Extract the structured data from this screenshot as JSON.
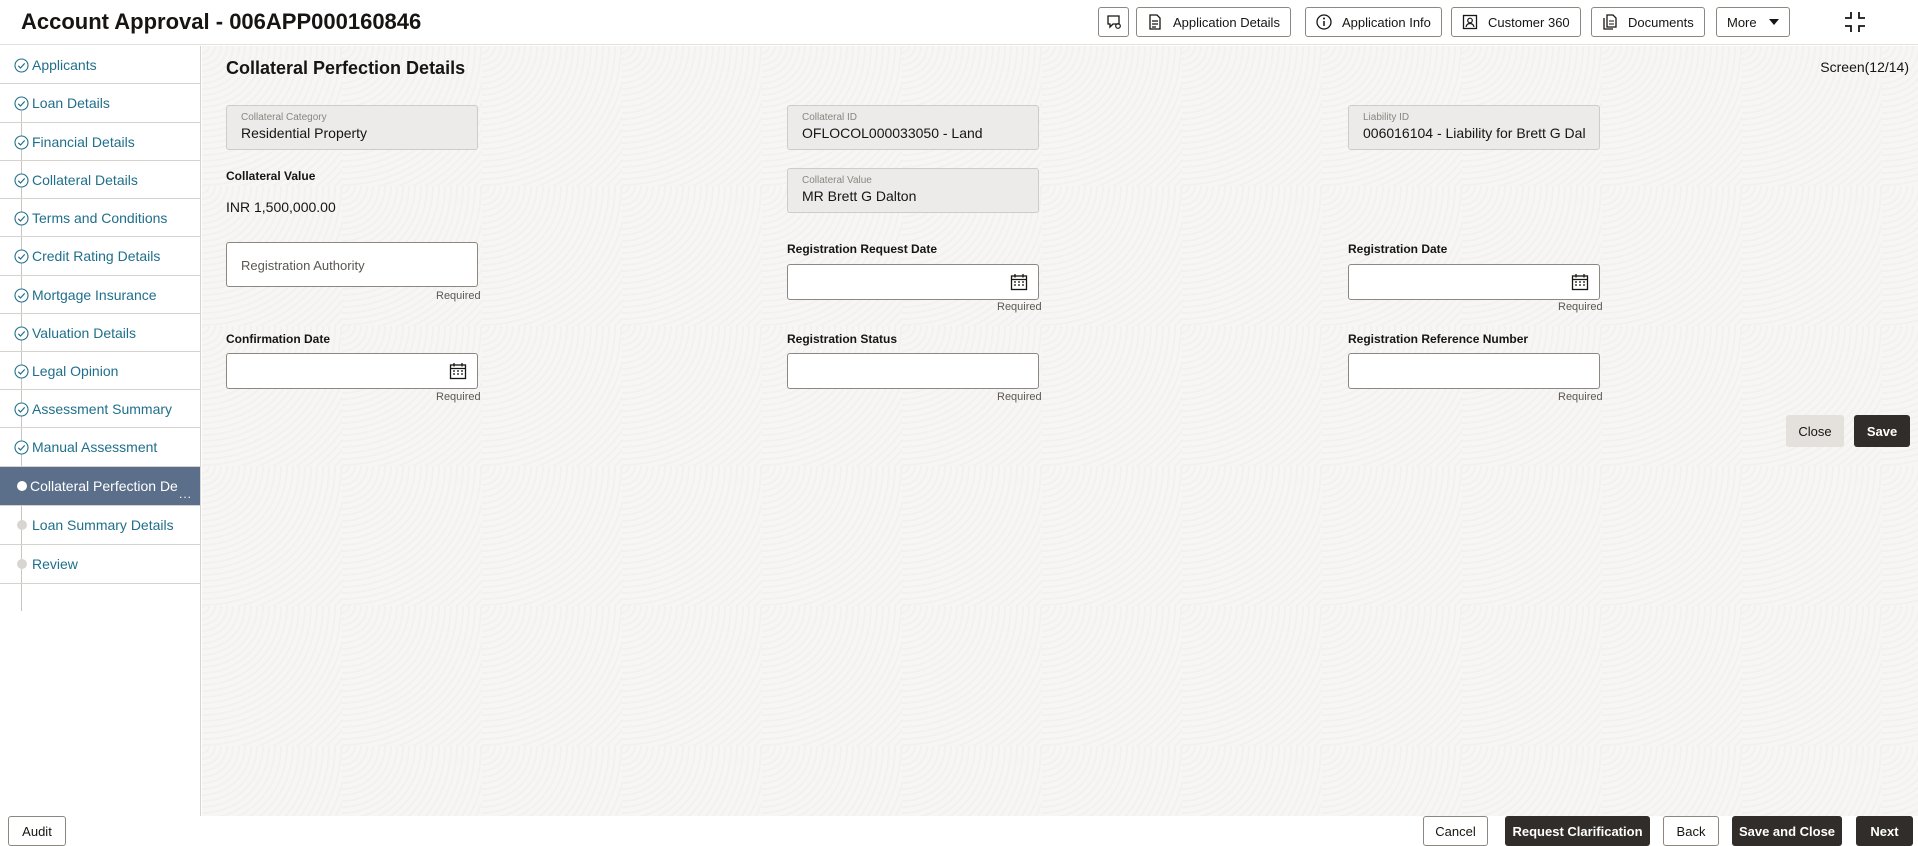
{
  "header": {
    "title": "Account Approval - 006APP000160846",
    "buttons": {
      "application_details": "Application Details",
      "application_info": "Application Info",
      "customer_360": "Customer 360",
      "documents": "Documents",
      "more": "More"
    }
  },
  "sidebar": {
    "items": [
      {
        "label": "Applicants",
        "state": "done"
      },
      {
        "label": "Loan Details",
        "state": "done"
      },
      {
        "label": "Financial Details",
        "state": "done"
      },
      {
        "label": "Collateral Details",
        "state": "done"
      },
      {
        "label": "Terms and Conditions",
        "state": "done"
      },
      {
        "label": "Credit Rating Details",
        "state": "done"
      },
      {
        "label": "Mortgage Insurance",
        "state": "done"
      },
      {
        "label": "Valuation Details",
        "state": "done"
      },
      {
        "label": "Legal Opinion",
        "state": "done"
      },
      {
        "label": "Assessment Summary",
        "state": "done"
      },
      {
        "label": "Manual Assessment",
        "state": "done"
      },
      {
        "label": "Collateral Perfection De",
        "state": "active",
        "overflow": "..."
      },
      {
        "label": "Loan Summary Details",
        "state": "pending"
      },
      {
        "label": "Review",
        "state": "pending"
      }
    ]
  },
  "main": {
    "title": "Collateral Perfection Details",
    "screen_indicator": "Screen(12/14)",
    "collateral_category": {
      "label": "Collateral Category",
      "value": "Residential Property"
    },
    "collateral_id": {
      "label": "Collateral ID",
      "value": "OFLOCOL000033050 - Land"
    },
    "liability_id": {
      "label": "Liability ID",
      "value": "006016104 - Liability for Brett G Dal"
    },
    "collateral_value_static": {
      "label": "Collateral Value",
      "value": "INR 1,500,000.00"
    },
    "collateral_value_field": {
      "label": "Collateral Value",
      "value": "MR Brett G Dalton"
    },
    "registration_authority": {
      "placeholder": "Registration Authority",
      "hint": "Required"
    },
    "registration_request_date": {
      "label": "Registration Request Date",
      "hint": "Required"
    },
    "registration_date": {
      "label": "Registration Date",
      "hint": "Required"
    },
    "confirmation_date": {
      "label": "Confirmation Date",
      "hint": "Required"
    },
    "registration_status": {
      "label": "Registration Status",
      "hint": "Required"
    },
    "registration_reference_number": {
      "label": "Registration Reference Number",
      "hint": "Required"
    },
    "close_label": "Close",
    "save_label": "Save"
  },
  "footer": {
    "audit": "Audit",
    "cancel": "Cancel",
    "request_clarification": "Request Clarification",
    "back": "Back",
    "save_and_close": "Save and Close",
    "next": "Next"
  },
  "colors": {
    "link": "#1f6f8b",
    "active_step": "#5c6f8a",
    "primary_button": "#312d2a",
    "check_icon": "#1f6f8b"
  },
  "icons": {
    "chat": "chat-bubble-icon",
    "details": "document-icon",
    "info": "info-icon",
    "customer": "user-card-icon",
    "documents": "documents-icon",
    "collapse": "collapse-icon",
    "calendar": "calendar-icon",
    "check": "check-circle-icon"
  }
}
